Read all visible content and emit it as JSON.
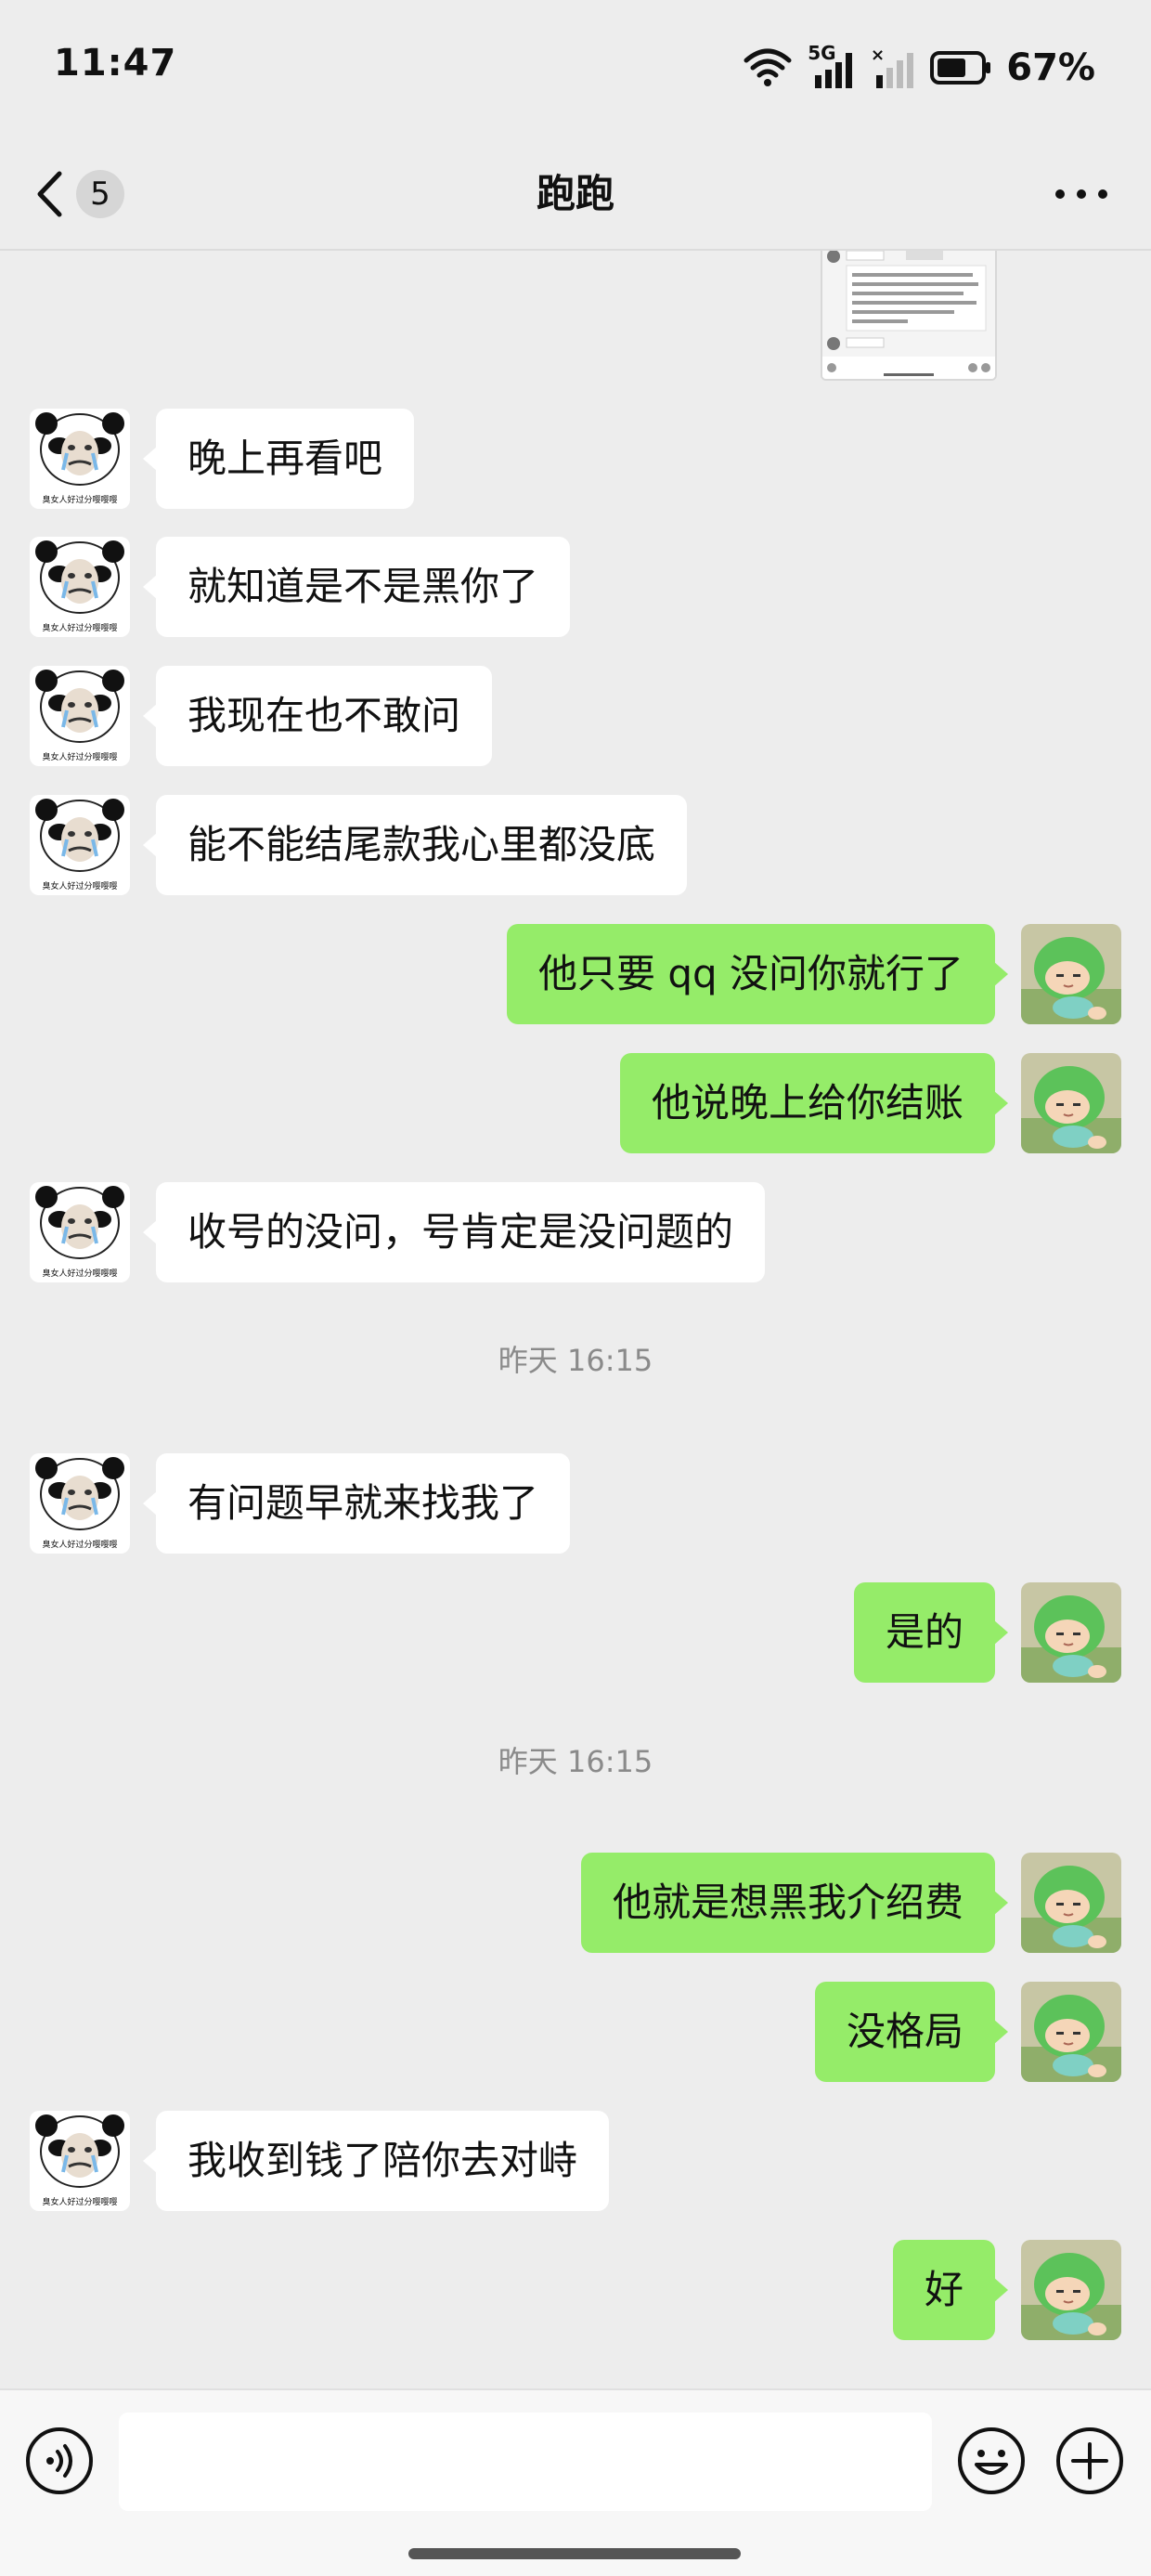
{
  "status_bar": {
    "time": "11:47",
    "network": "5G",
    "battery": "67%"
  },
  "header": {
    "unread_count": "5",
    "title": "跑跑"
  },
  "contact_avatar_caption": "臭女人好过分嘤嘤嘤",
  "messages": [
    {
      "side": "left",
      "text": "晚上再看吧"
    },
    {
      "side": "left",
      "text": "就知道是不是黑你了"
    },
    {
      "side": "left",
      "text": "我现在也不敢问"
    },
    {
      "side": "left",
      "text": "能不能结尾款我心里都没底"
    },
    {
      "side": "right",
      "text": "他只要 qq 没问你就行了"
    },
    {
      "side": "right",
      "text": "他说晚上给你结账"
    },
    {
      "side": "left",
      "text": "收号的没问，号肯定是没问题的"
    },
    {
      "side": "timestamp",
      "text": "昨天 16:15"
    },
    {
      "side": "left",
      "text": "有问题早就来找我了"
    },
    {
      "side": "right",
      "text": "是的"
    },
    {
      "side": "timestamp",
      "text": "昨天 16:15"
    },
    {
      "side": "right",
      "text": "他就是想黑我介绍费"
    },
    {
      "side": "right",
      "text": "没格局"
    },
    {
      "side": "left",
      "text": "我收到钱了陪你去对峙"
    },
    {
      "side": "right",
      "text": "好"
    }
  ],
  "colors": {
    "background": "#ededed",
    "sent_bubble": "#95ec69",
    "received_bubble": "#ffffff",
    "timestamp": "#8a8a8a"
  },
  "icons": {
    "back": "chevron-left-icon",
    "more": "more-dots-icon",
    "voice": "voice-icon",
    "emoji": "emoji-icon",
    "plus": "plus-icon"
  },
  "input": {
    "value": ""
  }
}
